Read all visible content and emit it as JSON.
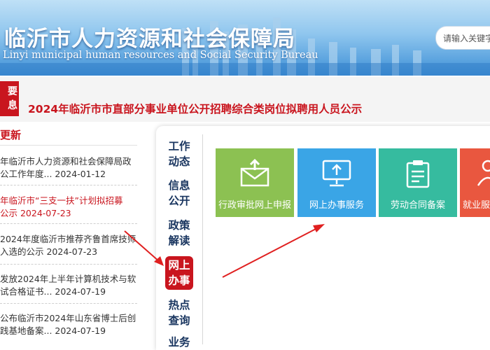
{
  "header": {
    "title": "临沂市人力资源和社会保障局",
    "subtitle": "Linyi municipal human resources and Social Security Bureau",
    "search_placeholder": "请输入关键字搜"
  },
  "important": {
    "badge": [
      "要",
      "息"
    ],
    "headline": "2024年临沂市市直部分事业单位公开招聘综合类岗位拟聘用人员公示"
  },
  "updates": {
    "title": "更新",
    "items": [
      {
        "line1": "年临沂市人力资源和社会保障局政",
        "line2": "公工作年度... 2024-01-12",
        "color": "#333333"
      },
      {
        "line1": "年临沂市“三支一扶”计划拟招募",
        "line2": "公示 2024-07-23",
        "color": "#c9151e"
      },
      {
        "line1": "2024年度临沂市推荐齐鲁首席技师",
        "line2": "入选的公示 2024-07-23",
        "color": "#333333"
      },
      {
        "line1": "发放2024年上半年计算机技术与软",
        "line2": "试合格证书... 2024-07-19",
        "color": "#333333"
      },
      {
        "line1": "公布临沂市2024年山东省博士后创",
        "line2": "践基地备案... 2024-07-19",
        "color": "#333333"
      }
    ]
  },
  "nav_tabs": [
    {
      "line1": "工作",
      "line2": "动态",
      "active": false
    },
    {
      "line1": "信息",
      "line2": "公开",
      "active": false
    },
    {
      "line1": "政策",
      "line2": "解读",
      "active": false
    },
    {
      "line1": "网上",
      "line2": "办事",
      "active": true
    },
    {
      "line1": "热点",
      "line2": "查询",
      "active": false
    },
    {
      "line1": "业务",
      "line2": "",
      "active": false
    }
  ],
  "service_tiles": [
    {
      "label": "行政审批网上申报",
      "icon": "envelope-icon",
      "color": "#8cc152"
    },
    {
      "label": "网上办事服务",
      "icon": "monitor-upload-icon",
      "color": "#3aa5e6"
    },
    {
      "label": "劳动合同备案",
      "icon": "clipboard-icon",
      "color": "#36bb9f"
    },
    {
      "label": "就业服",
      "icon": "person-icon",
      "color": "#e9573f"
    }
  ],
  "colors": {
    "accent_red": "#c9151e",
    "nav_text": "#1a3660",
    "banner_blue": "#3d8fd6"
  }
}
